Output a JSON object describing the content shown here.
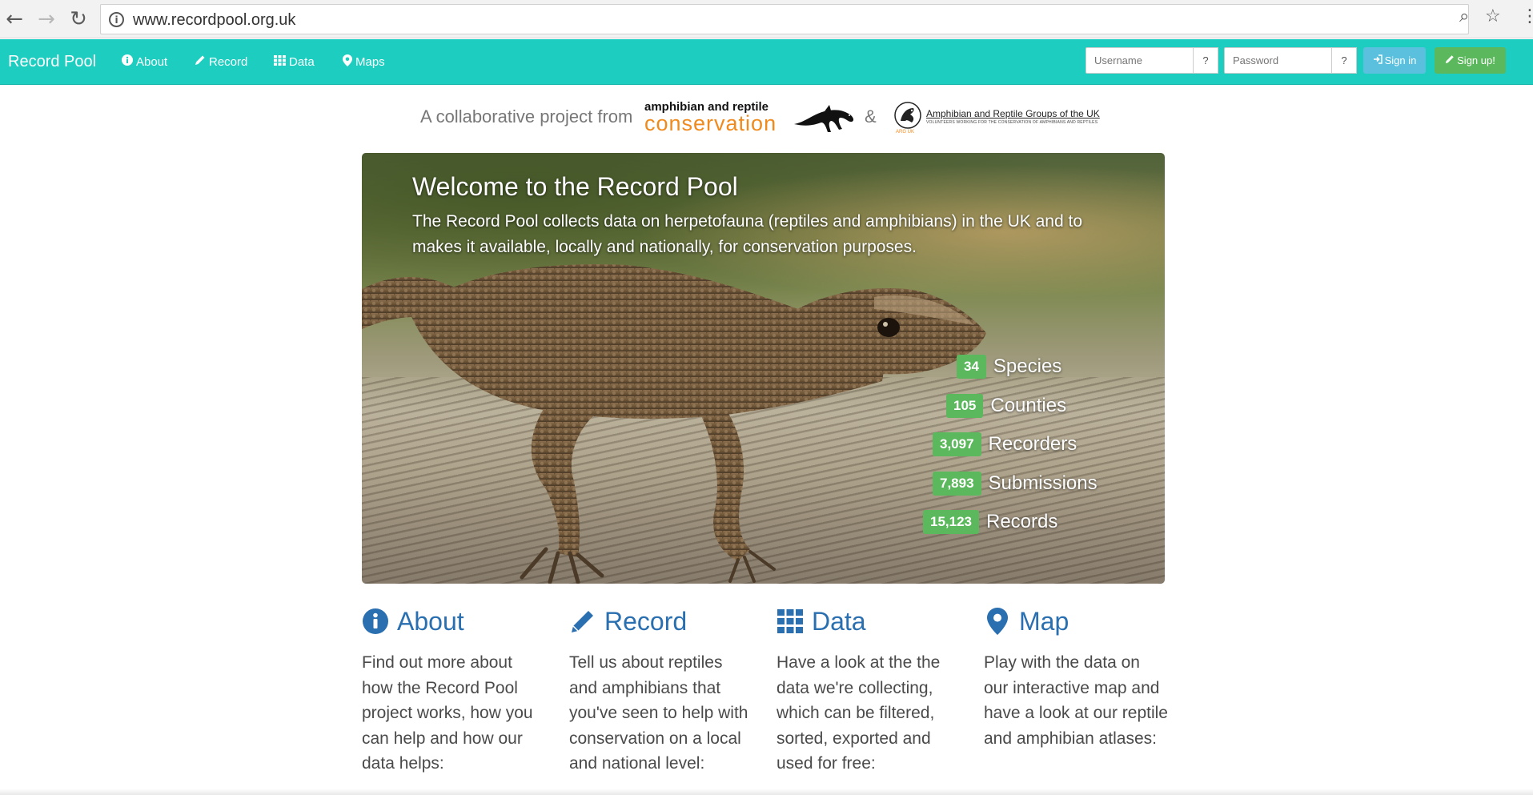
{
  "browser": {
    "url": "www.recordpool.org.uk"
  },
  "navbar": {
    "brand": "Record Pool",
    "links": [
      {
        "label": "About",
        "icon": "info-circle-icon"
      },
      {
        "label": "Record",
        "icon": "pencil-icon"
      },
      {
        "label": "Data",
        "icon": "grid-icon"
      },
      {
        "label": "Maps",
        "icon": "map-marker-icon"
      }
    ],
    "login": {
      "username_placeholder": "Username",
      "password_placeholder": "Password",
      "help_label": "?",
      "signin_label": "Sign in",
      "signup_label": "Sign up!"
    },
    "colors": {
      "bar": "#1dcdc0",
      "signin": "#5bc0de",
      "signup": "#5cb85c"
    }
  },
  "collab": {
    "text": "A collaborative project from",
    "arc_line1": "amphibian and reptile",
    "arc_line2": "conservation",
    "ampersand": "&",
    "arguk_title": "Amphibian and Reptile Groups of the UK",
    "arguk_sub": "VOLUNTEERS WORKING FOR THE CONSERVATION OF AMPHIBIANS AND REPTILES",
    "arguk_abbr": "ARG UK"
  },
  "hero": {
    "title": "Welcome to the Record Pool",
    "text": "The Record Pool collects data on herpetofauna (reptiles and amphibians) in the UK and to makes it available, locally and nationally, for conservation purposes.",
    "stats": [
      {
        "value": "34",
        "label": "Species"
      },
      {
        "value": "105",
        "label": "Counties"
      },
      {
        "value": "3,097",
        "label": "Recorders"
      },
      {
        "value": "7,893",
        "label": "Submissions"
      },
      {
        "value": "15,123",
        "label": "Records"
      }
    ]
  },
  "features": [
    {
      "title": "About",
      "icon": "info-circle-icon",
      "text": "Find out more about how the Record Pool project works, how you can help and how our data helps:"
    },
    {
      "title": "Record",
      "icon": "pencil-icon",
      "text": "Tell us about reptiles and amphibians that you've seen to help with conservation on a local and national level:"
    },
    {
      "title": "Data",
      "icon": "grid-icon",
      "text": "Have a look at the the data we're collecting, which can be filtered, sorted, exported and used for free:"
    },
    {
      "title": "Map",
      "icon": "map-marker-icon",
      "text": "Play with the data on our interactive map and have a look at our reptile and amphibian atlases:"
    }
  ]
}
